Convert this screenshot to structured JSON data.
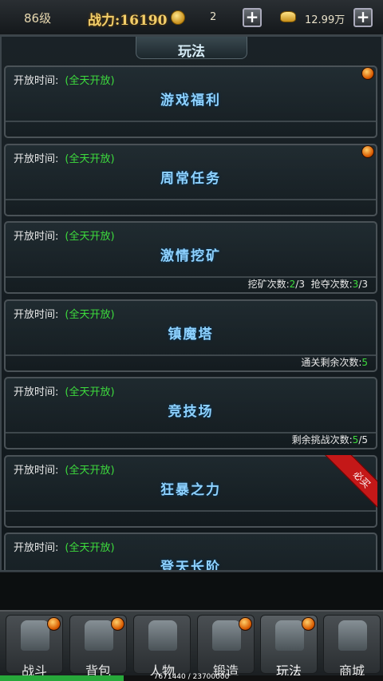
{
  "topbar": {
    "level": "86级",
    "power_label": "战力:",
    "power_value": "16190",
    "coin_count": "2",
    "gold_amount": "12.99万"
  },
  "panel": {
    "title": "玩法"
  },
  "open_time_label": "开放时间:",
  "cards": [
    {
      "name": "游戏福利",
      "open_time": "(全天开放)",
      "badge": true
    },
    {
      "name": "周常任务",
      "open_time": "(全天开放)",
      "badge": true
    },
    {
      "name": "激情挖矿",
      "open_time": "(全天开放)",
      "footer": [
        {
          "label": "挖矿次数:",
          "value": "2",
          "total": "/3"
        },
        {
          "label": "抢夺次数:",
          "value": "3",
          "total": "/3"
        }
      ]
    },
    {
      "name": "镇魔塔",
      "open_time": "(全天开放)",
      "footer": [
        {
          "label": "通关剩余次数:",
          "value": "5",
          "total": ""
        }
      ]
    },
    {
      "name": "竞技场",
      "open_time": "(全天开放)",
      "footer": [
        {
          "label": "剩余挑战次数:",
          "value": "5",
          "total": "/5"
        }
      ]
    },
    {
      "name": "狂暴之力",
      "open_time": "(全天开放)",
      "ribbon": "必买"
    },
    {
      "name": "登天长阶",
      "open_time": "(全天开放)"
    }
  ],
  "nav": [
    {
      "label": "战斗",
      "icon": "swords-icon",
      "badge": true
    },
    {
      "label": "背包",
      "icon": "backpack-icon",
      "badge": true
    },
    {
      "label": "人物",
      "icon": "helmet-icon",
      "badge": false
    },
    {
      "label": "锻造",
      "icon": "anvil-icon",
      "badge": true
    },
    {
      "label": "玩法",
      "icon": "winged-emblem-icon",
      "badge": true,
      "active": true
    },
    {
      "label": "商城",
      "icon": "shop-icon",
      "badge": false
    }
  ],
  "exp": {
    "text": "7671440 / 23700000",
    "fraction": 0.3237
  }
}
